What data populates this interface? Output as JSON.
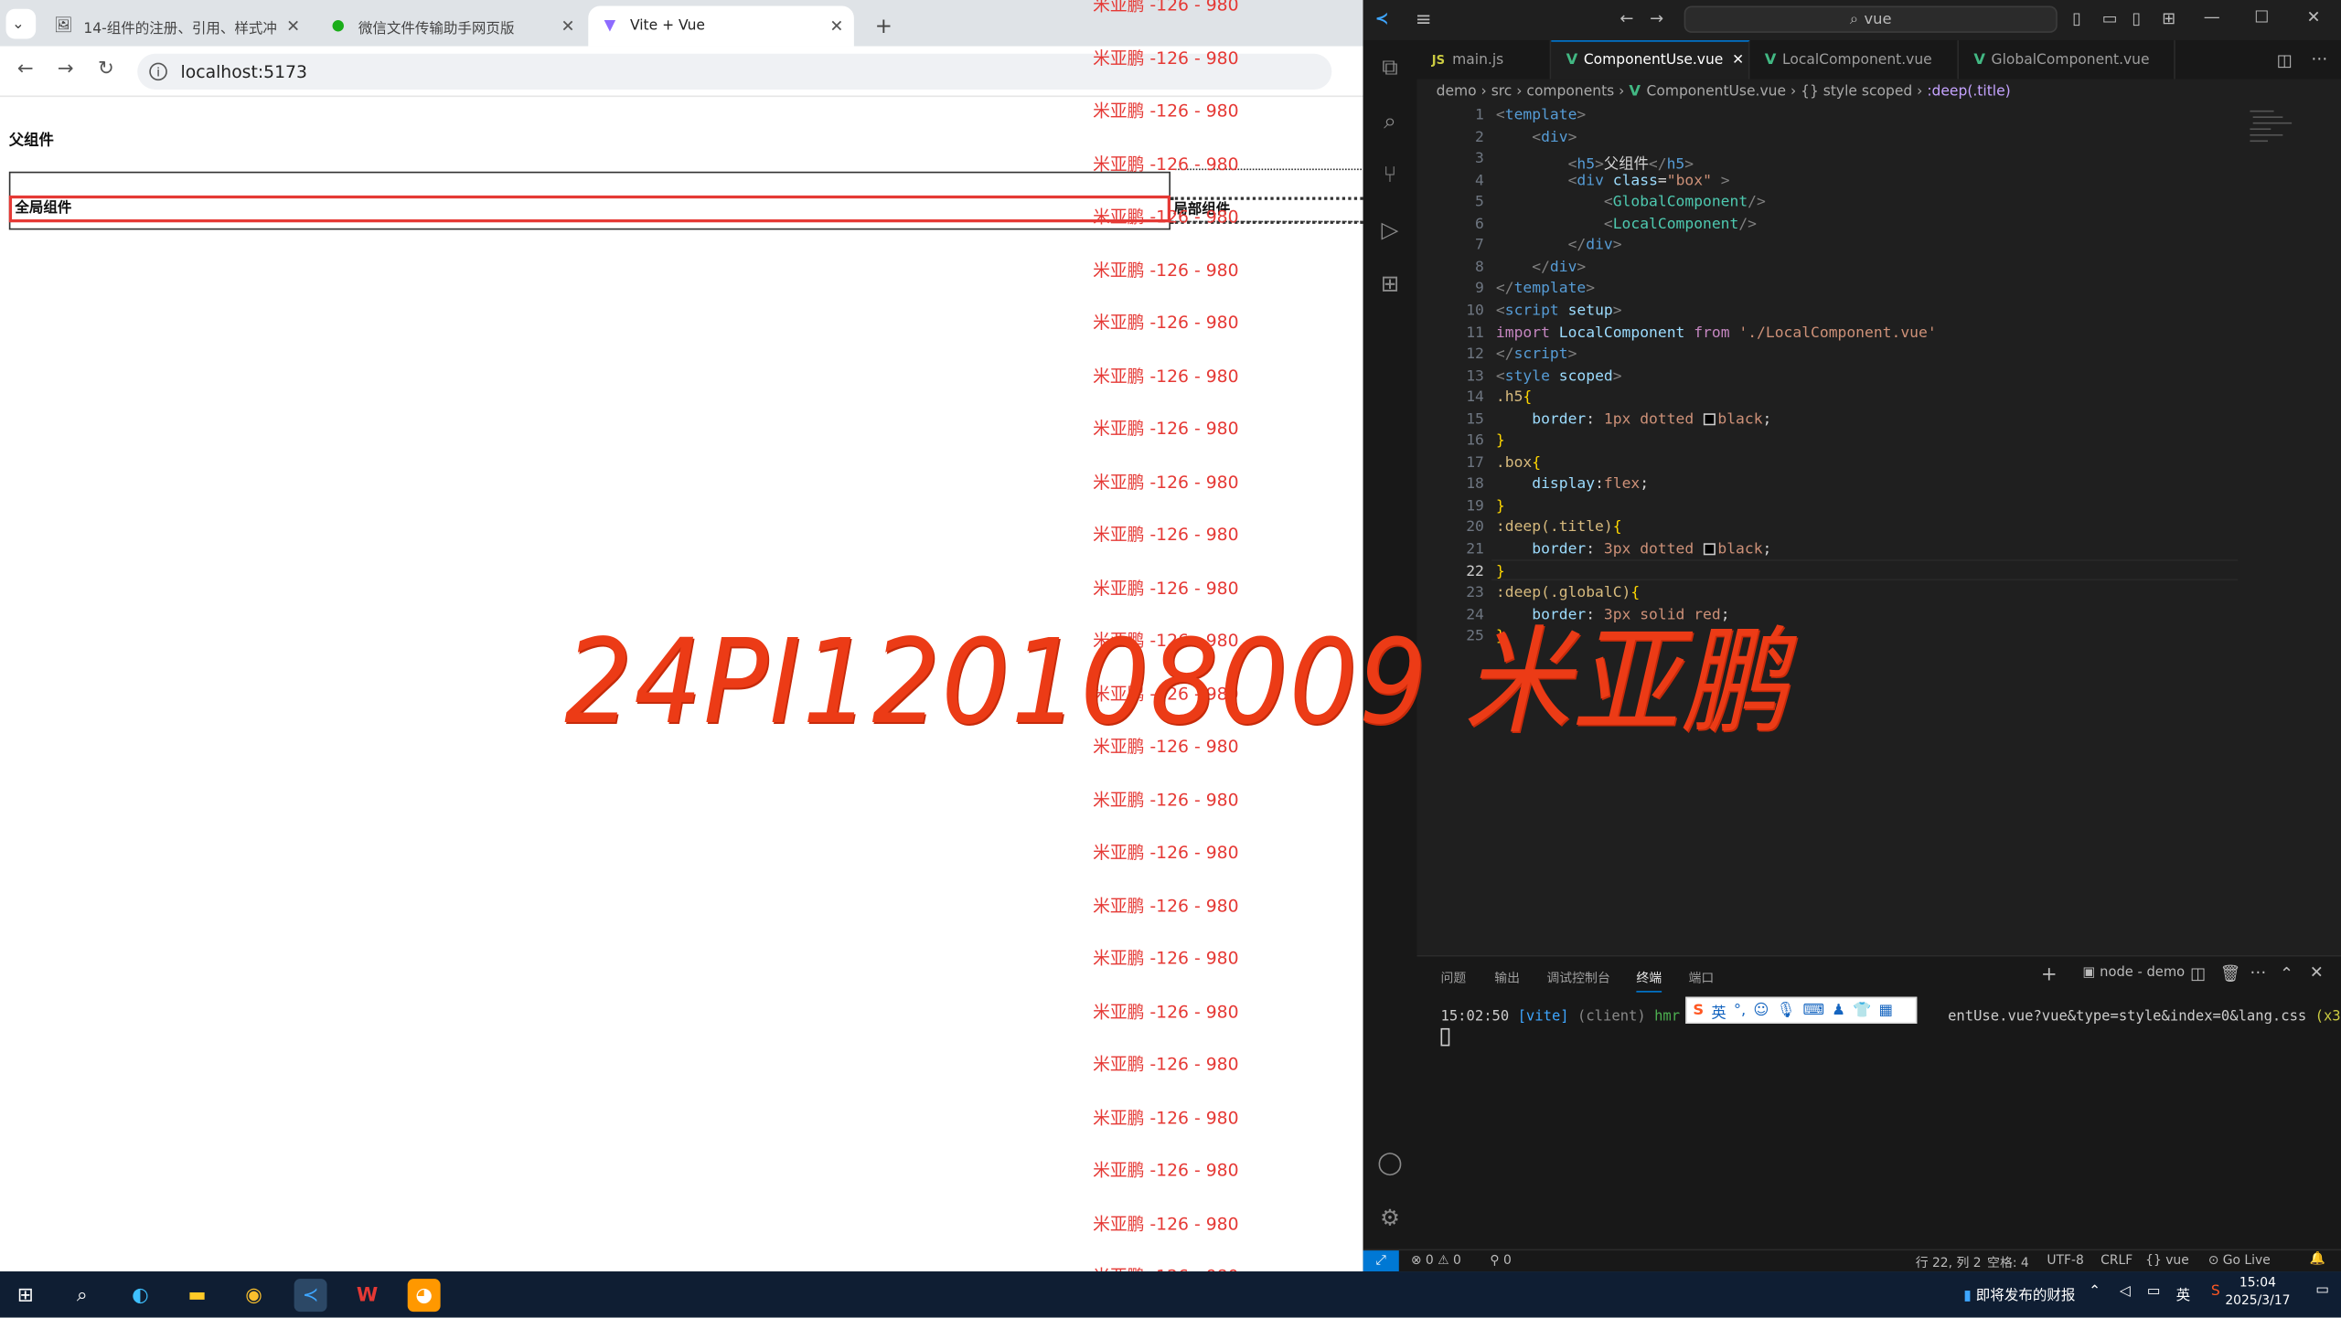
{
  "browser": {
    "tabs": [
      {
        "label": "14-组件的注册、引用、样式冲",
        "icon": "image-icon"
      },
      {
        "label": "微信文件传输助手网页版",
        "icon": "wechat-icon"
      },
      {
        "label": "Vite + Vue",
        "icon": "vite-icon"
      }
    ],
    "url": "localhost:5173"
  },
  "page": {
    "parent_title": "父组件",
    "global_component": "全局组件",
    "local_component": "局部组件"
  },
  "watermark": {
    "line": "米亚鹏 -126 - 980",
    "big": "24PI120108009 米亚鹏",
    "color": "#e53935"
  },
  "vscode": {
    "search": "vue",
    "tabs": [
      "main.js",
      "ComponentUse.vue",
      "LocalComponent.vue",
      "GlobalComponent.vue"
    ],
    "breadcrumb": [
      "demo",
      "src",
      "components",
      "ComponentUse.vue",
      "{} style scoped",
      ":deep(.title)"
    ],
    "panel_tabs": [
      "问题",
      "输出",
      "调试控制台",
      "终端",
      "端口"
    ],
    "terminal_name": "node - demo",
    "terminal_line_time": "15:02:50",
    "terminal_line_tag": "[vite]",
    "terminal_line_client": "(client)",
    "terminal_line_hmr": "hmr u",
    "terminal_line_rest": "entUse.vue?vue&type=style&index=0&lang.css",
    "terminal_line_count": "(x3)",
    "ime_label": "英",
    "status": {
      "errors": "0",
      "warnings": "0",
      "ports": "0",
      "position": "行 22, 列 2",
      "spaces": "空格: 4",
      "encoding": "UTF-8",
      "eol": "CRLF",
      "language": "vue",
      "golive": "Go Live"
    },
    "code_lines": [
      "1",
      "2",
      "3",
      "4",
      "5",
      "6",
      "7",
      "8",
      "9",
      "10",
      "11",
      "12",
      "13",
      "14",
      "15",
      "16",
      "17",
      "18",
      "19",
      "20",
      "21",
      "22",
      "23",
      "24",
      "25"
    ]
  },
  "taskbar": {
    "news": "即将发布的财报",
    "ime": "英",
    "time": "15:04",
    "date": "2025/3/17"
  },
  "colors": {
    "accent": "#0078d4",
    "vue_green": "#42b883",
    "watermark": "#e53935"
  }
}
